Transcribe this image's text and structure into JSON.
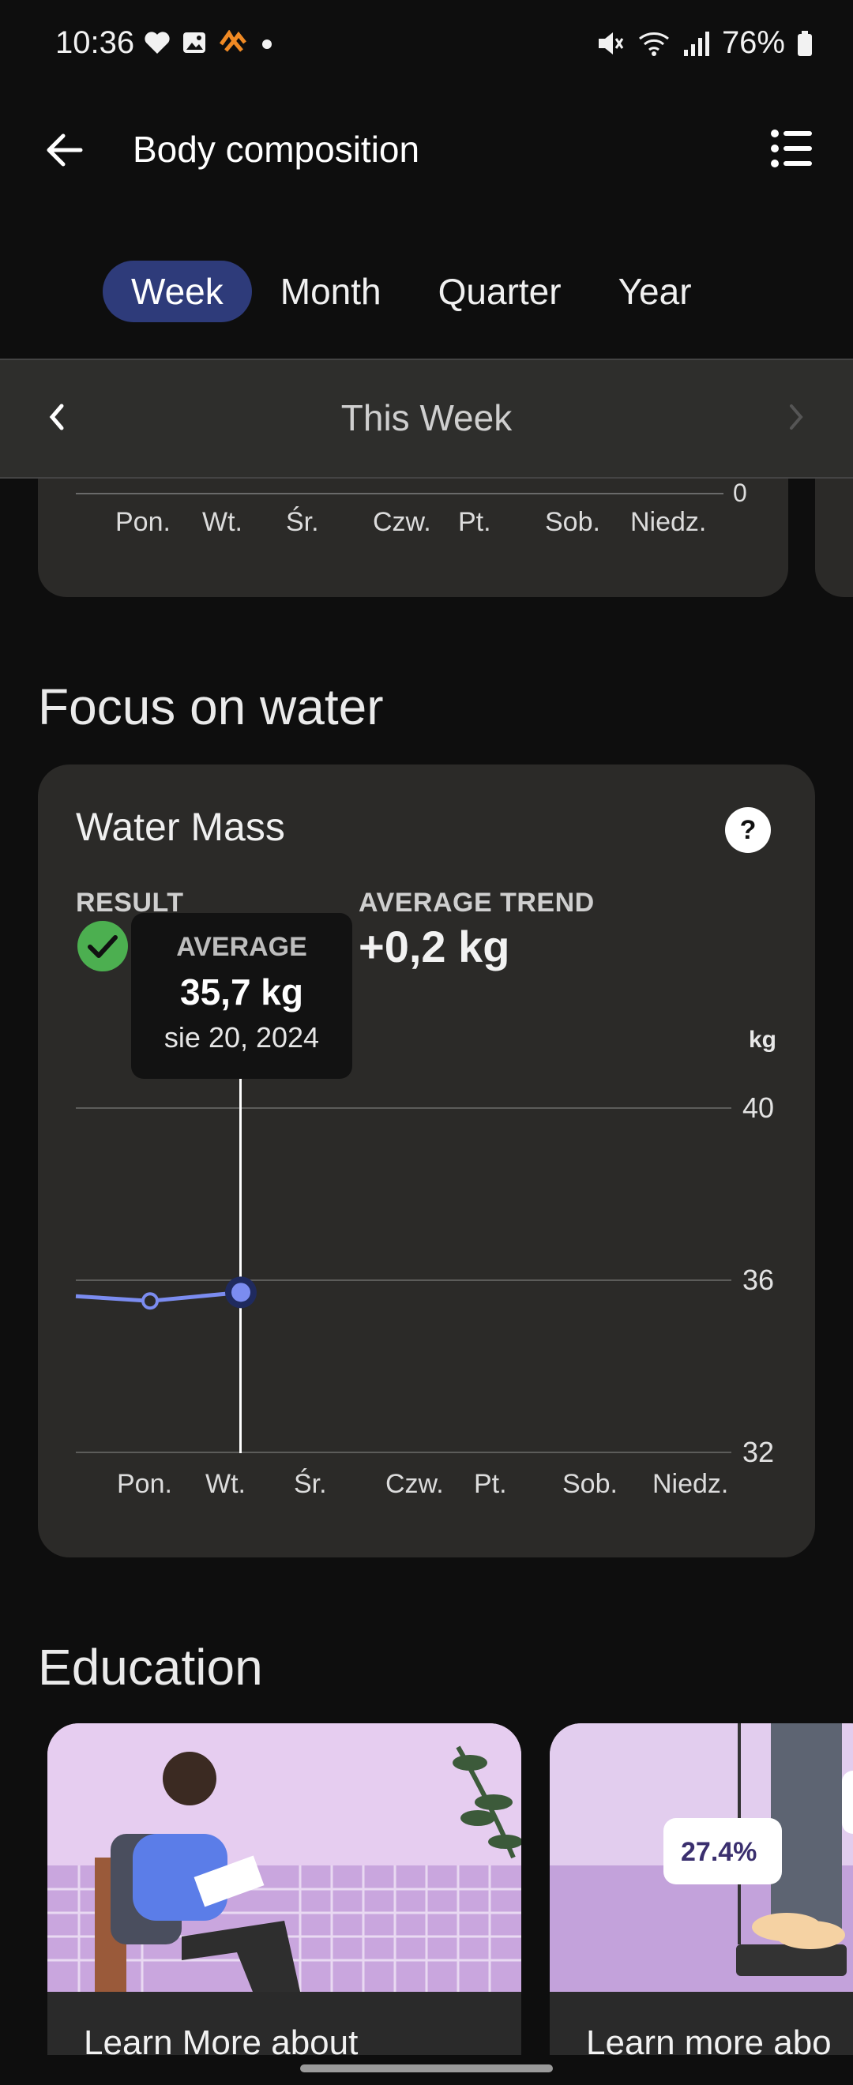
{
  "status": {
    "time": "10:36",
    "battery": "76%"
  },
  "header": {
    "title": "Body composition"
  },
  "tabs": [
    {
      "label": "Week",
      "active": true
    },
    {
      "label": "Month",
      "active": false
    },
    {
      "label": "Quarter",
      "active": false
    },
    {
      "label": "Year",
      "active": false
    }
  ],
  "period": {
    "label": "This Week"
  },
  "prev_chart": {
    "zero_label": "0",
    "days": [
      "Pon.",
      "Wt.",
      "Śr.",
      "Czw.",
      "Pt.",
      "Sob.",
      "Niedz."
    ]
  },
  "focus": {
    "heading": "Focus on water",
    "card_title": "Water Mass",
    "help_label": "?",
    "result_label": "RESULT",
    "trend_label": "AVERAGE TREND",
    "trend_value": "+0,2 kg",
    "tooltip": {
      "label": "AVERAGE",
      "value": "35,7 kg",
      "date": "sie 20, 2024"
    }
  },
  "chart_data": {
    "type": "line",
    "categories": [
      "Pon.",
      "Wt.",
      "Śr.",
      "Czw.",
      "Pt.",
      "Sob.",
      "Niedz."
    ],
    "values": [
      35.5,
      35.7,
      null,
      null,
      null,
      null,
      null
    ],
    "ylabel": "kg",
    "yticks": [
      "40",
      "36",
      "32"
    ],
    "ylim": [
      32,
      40
    ],
    "selected_index": 1,
    "line_color": "#7b8cf0"
  },
  "education": {
    "heading": "Education",
    "cards": [
      {
        "title": "Learn More about"
      },
      {
        "title": "Learn more abo",
        "badge": "27.4%"
      }
    ]
  },
  "colors": {
    "accent": "#2e3b7a",
    "check": "#4caf50"
  }
}
